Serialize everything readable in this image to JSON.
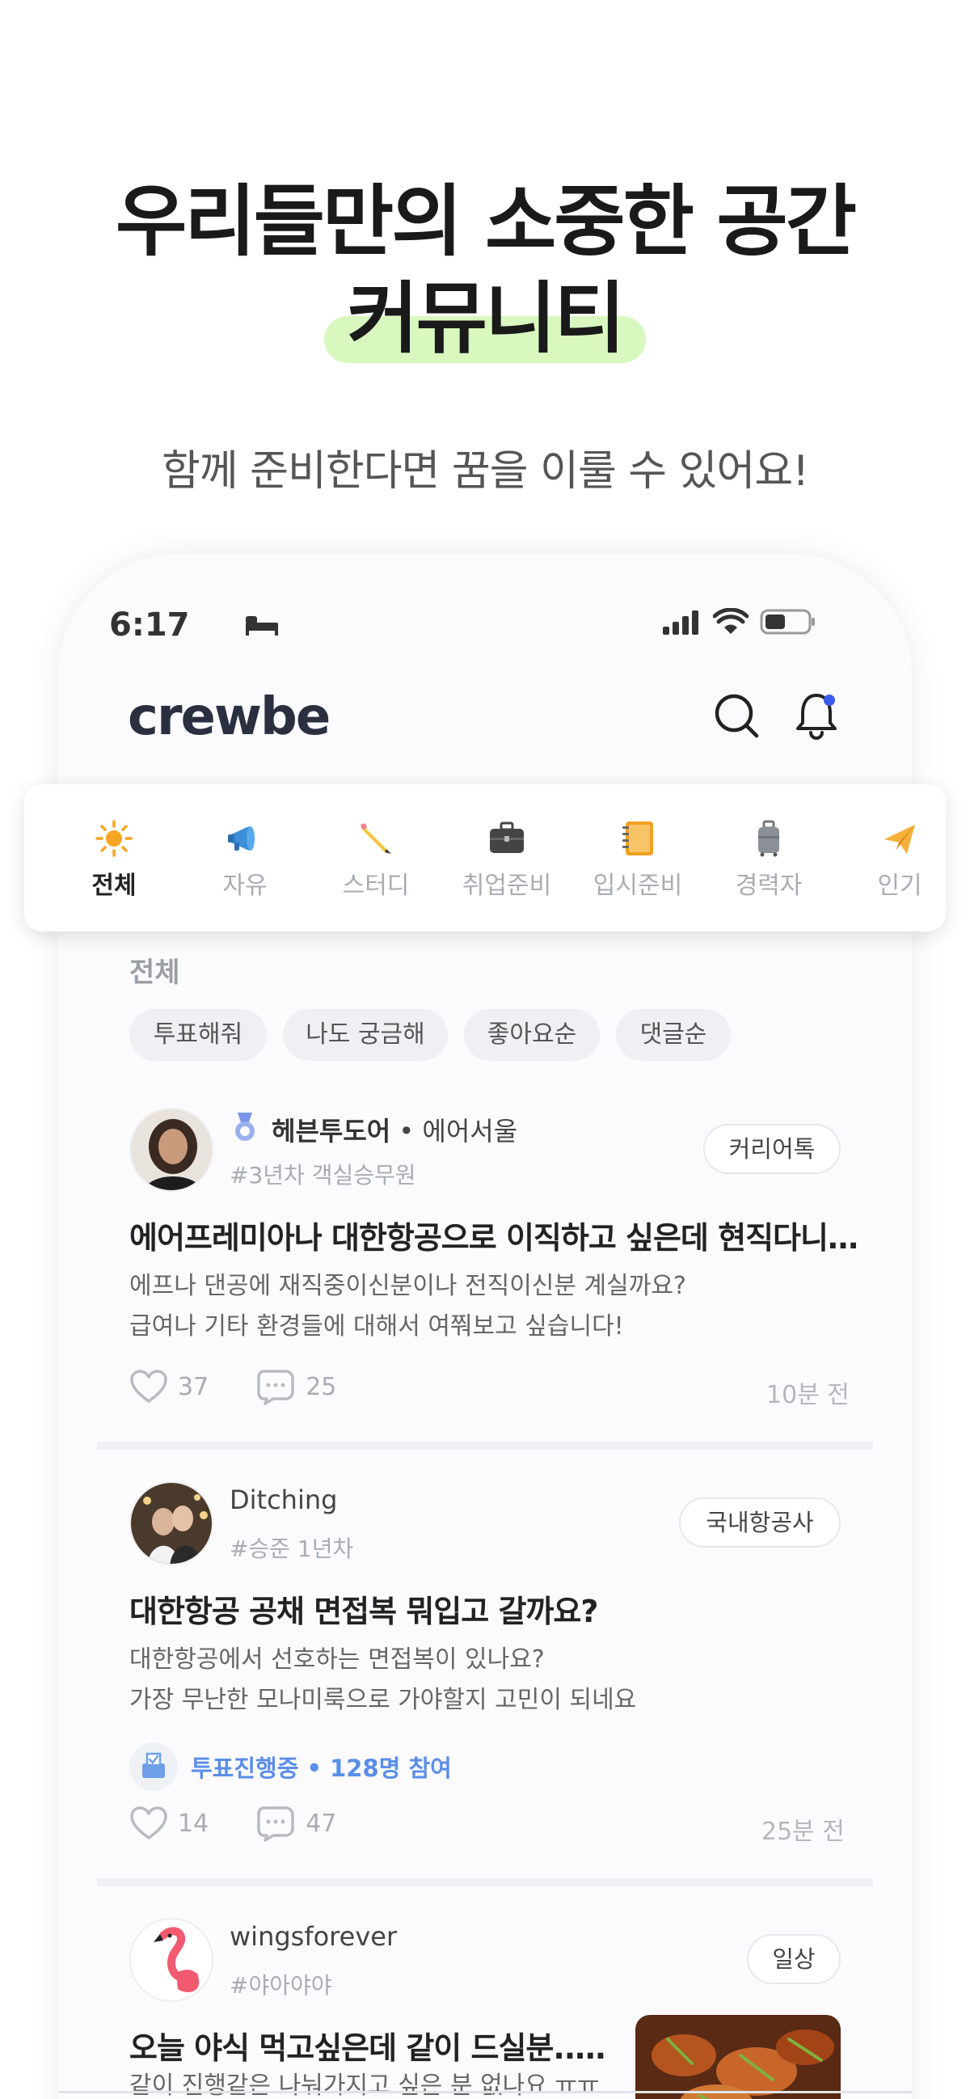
{
  "hero": {
    "title_line1": "우리들만의 소중한 공간",
    "title_line2": "커뮤니티",
    "subtitle": "함께 준비한다면 꿈을 이룰 수 있어요!"
  },
  "status_bar": {
    "time": "6:17"
  },
  "app": {
    "logo": "crewbe"
  },
  "categories": [
    {
      "label": "전체",
      "icon": "sun-icon",
      "active": true
    },
    {
      "label": "자유",
      "icon": "megaphone-icon"
    },
    {
      "label": "스터디",
      "icon": "pencil-icon"
    },
    {
      "label": "취업준비",
      "icon": "briefcase-icon"
    },
    {
      "label": "입시준비",
      "icon": "notebook-icon"
    },
    {
      "label": "경력자",
      "icon": "luggage-icon"
    },
    {
      "label": "인기",
      "icon": "paper-plane-icon"
    }
  ],
  "section_label": "전체",
  "filters": [
    "투표해줘",
    "나도 궁금해",
    "좋아요순",
    "댓글순"
  ],
  "posts": [
    {
      "author": "헤븐투도어",
      "affiliation": "• 에어서울",
      "sub": "#3년차 객실승무원",
      "tag": "커리어톡",
      "title": "에어프레미아나 대한항공으로 이직하고 싶은데 현직다니…",
      "body_line1": "에프나 댄공에 재직중이신분이나 전직이신분 계실까요?",
      "body_line2": "급여나 기타 환경들에 대해서 여쭤보고 싶습니다!",
      "likes": "37",
      "comments": "25",
      "time": "10분 전"
    },
    {
      "author": "Ditching",
      "sub": "#승준 1년차",
      "tag": "국내항공사",
      "title": "대한항공 공채 면접복 뭐입고 갈까요?",
      "body_line1": "대한항공에서 선호하는 면접복이 있나요?",
      "body_line2": "가장 무난한 모나미룩으로 가야할지 고민이 되네요",
      "vote": "투표진행중 • 128명 참여",
      "likes": "14",
      "comments": "47",
      "time": "25분 전"
    },
    {
      "author": "wingsforever",
      "sub": "#야아야야",
      "tag": "일상",
      "title": "오늘 야식 먹고싶은데 같이 드실분..…",
      "body_line1": "같이 진행같은 나눠가지고 싶은 분 없나요 ㅠㅠ"
    }
  ]
}
